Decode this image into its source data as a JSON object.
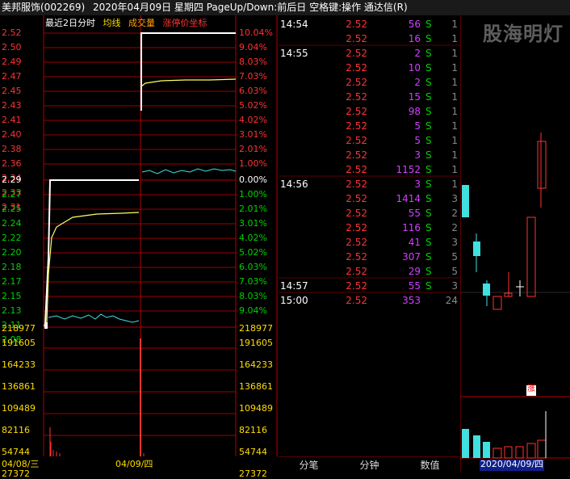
{
  "header": {
    "stock": "美邦服饰(002269)",
    "title": "2020年04月09日 星期四 PageUp/Down:前后日 空格键:操作 通达信(R)"
  },
  "legend": {
    "label": "最近2日分时",
    "avg_line": "均线",
    "volume": "成交量",
    "limit": "涨停价坐标"
  },
  "price_axis": {
    "top_labels": [
      "2.52",
      "2.50",
      "2.49",
      "2.47",
      "2.45",
      "2.43",
      "2.41",
      "2.40",
      "2.38",
      "2.36",
      "2.34",
      "2.33",
      "2.31"
    ],
    "top_pct": [
      "10.04%",
      "9.04%",
      "8.03%",
      "7.03%",
      "6.03%",
      "5.02%",
      "4.02%",
      "3.01%",
      "2.01%",
      "1.00%"
    ],
    "mid_label": "2.29",
    "mid_pct": "0.00%",
    "bottom_labels": [
      "2.27",
      "2.25",
      "2.24",
      "2.22",
      "2.20",
      "2.18",
      "2.17",
      "2.15",
      "2.13",
      "2.11",
      "2.08"
    ],
    "bottom_pct": [
      "1.00%",
      "2.01%",
      "3.01%",
      "4.02%",
      "5.02%",
      "6.03%",
      "7.03%",
      "8.03%",
      "9.04%"
    ]
  },
  "volume_axis": [
    "218977",
    "191605",
    "164233",
    "136861",
    "109489",
    "82116",
    "54744",
    "27372"
  ],
  "dates": {
    "day1": "04/08/三",
    "day2": "04/09/四"
  },
  "trades": [
    {
      "time": "14:54",
      "price": "2.52",
      "vol": "56",
      "bs": "S",
      "n": "1"
    },
    {
      "time": "",
      "price": "2.52",
      "vol": "16",
      "bs": "S",
      "n": "1"
    },
    {
      "time": "14:55",
      "price": "2.52",
      "vol": "2",
      "bs": "S",
      "n": "1"
    },
    {
      "time": "",
      "price": "2.52",
      "vol": "10",
      "bs": "S",
      "n": "1"
    },
    {
      "time": "",
      "price": "2.52",
      "vol": "2",
      "bs": "S",
      "n": "1"
    },
    {
      "time": "",
      "price": "2.52",
      "vol": "15",
      "bs": "S",
      "n": "1"
    },
    {
      "time": "",
      "price": "2.52",
      "vol": "98",
      "bs": "S",
      "n": "1"
    },
    {
      "time": "",
      "price": "2.52",
      "vol": "5",
      "bs": "S",
      "n": "1"
    },
    {
      "time": "",
      "price": "2.52",
      "vol": "5",
      "bs": "S",
      "n": "1"
    },
    {
      "time": "",
      "price": "2.52",
      "vol": "3",
      "bs": "S",
      "n": "1"
    },
    {
      "time": "",
      "price": "2.52",
      "vol": "1152",
      "bs": "S",
      "n": "1"
    },
    {
      "time": "14:56",
      "price": "2.52",
      "vol": "3",
      "bs": "S",
      "n": "1"
    },
    {
      "time": "",
      "price": "2.52",
      "vol": "1414",
      "bs": "S",
      "n": "3"
    },
    {
      "time": "",
      "price": "2.52",
      "vol": "55",
      "bs": "S",
      "n": "2"
    },
    {
      "time": "",
      "price": "2.52",
      "vol": "116",
      "bs": "S",
      "n": "2"
    },
    {
      "time": "",
      "price": "2.52",
      "vol": "41",
      "bs": "S",
      "n": "3"
    },
    {
      "time": "",
      "price": "2.52",
      "vol": "307",
      "bs": "S",
      "n": "5"
    },
    {
      "time": "",
      "price": "2.52",
      "vol": "29",
      "bs": "S",
      "n": "5"
    },
    {
      "time": "14:57",
      "price": "2.52",
      "vol": "55",
      "bs": "S",
      "n": "3"
    },
    {
      "time": "15:00",
      "price": "2.52",
      "vol": "353",
      "bs": "",
      "n": "24"
    }
  ],
  "tabs": [
    "分笔",
    "分钟",
    "数值"
  ],
  "kline": {
    "badge": "涨",
    "date": "2020/04/09/四"
  },
  "watermark": "股海明灯",
  "colors": {
    "up": "#ff3232",
    "down": "#00d200",
    "grid": "#b00000",
    "avg": "#ffff64",
    "price_line": "#ffffff",
    "flat": "#40e0e0"
  }
}
